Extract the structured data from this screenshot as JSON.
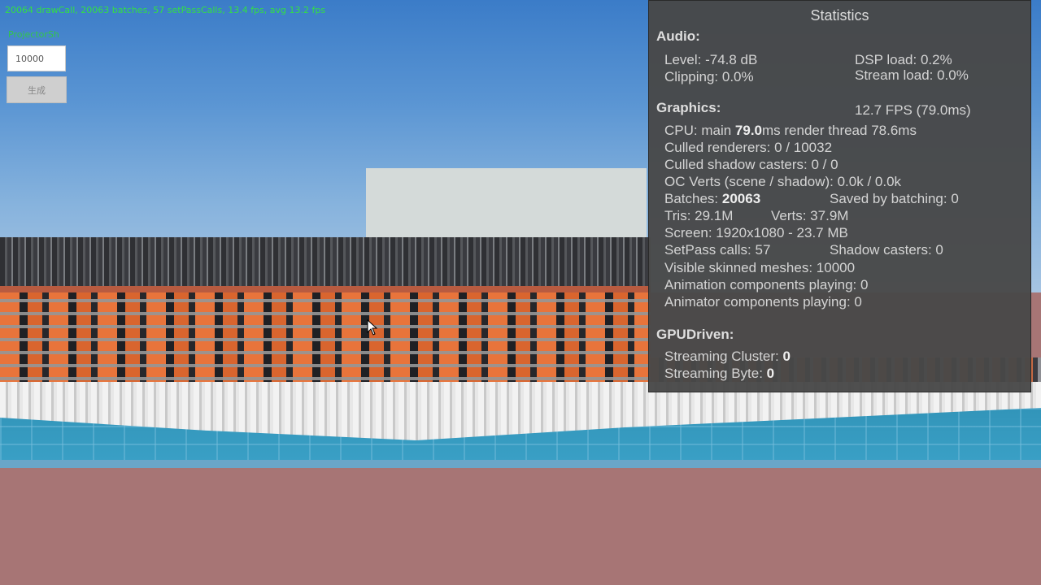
{
  "overlay": {
    "stats_line": "20064 drawCall, 20063 batches, 57 setPassCalls, 13.4 fps, avg 13.2 fps",
    "field_label": "ProjectorSh",
    "count_value": "10000",
    "generate_label": "生成"
  },
  "statistics": {
    "title": "Statistics",
    "audio": {
      "heading": "Audio:",
      "level": "Level: -74.8 dB",
      "dsp_load": "DSP load: 0.2%",
      "clipping": "Clipping: 0.0%",
      "stream_load": "Stream load: 0.0%"
    },
    "graphics": {
      "heading": "Graphics:",
      "fps": "12.7 FPS (79.0ms)",
      "cpu_prefix": "CPU: main ",
      "cpu_main": "79.0",
      "cpu_suffix": "ms  render thread 78.6ms",
      "culled_renderers": "Culled renderers: 0 / 10032",
      "culled_shadow": "Culled shadow casters: 0 / 0",
      "oc_verts": "OC Verts (scene / shadow): 0.0k / 0.0k",
      "batches_label": "Batches: ",
      "batches_value": "20063",
      "saved_batching": "Saved by batching: 0",
      "tris": "Tris: 29.1M",
      "verts": "Verts: 37.9M",
      "screen": "Screen: 1920x1080 - 23.7 MB",
      "setpass": "SetPass calls: 57",
      "shadow_casters": "Shadow casters: 0",
      "skinned": "Visible skinned meshes: 10000",
      "animation": "Animation components playing: 0",
      "animator": "Animator components playing: 0"
    },
    "gpudriven": {
      "heading": "GPUDriven:",
      "cluster_label": "Streaming Cluster: ",
      "cluster_value": "0",
      "byte_label": "Streaming Byte: ",
      "byte_value": "0"
    }
  }
}
